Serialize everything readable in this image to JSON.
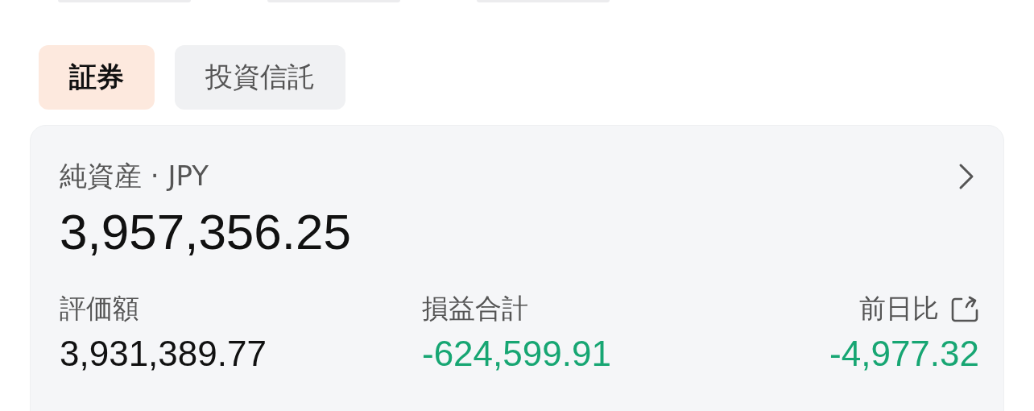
{
  "tabs": [
    {
      "label": "証券",
      "selected": true
    },
    {
      "label": "投資信託",
      "selected": false
    }
  ],
  "summary": {
    "title": "純資産 · JPY",
    "value": "3,957,356.25",
    "metrics": [
      {
        "label": "評価額",
        "value": "3,931,389.77",
        "color": "#111111",
        "share": false
      },
      {
        "label": "損益合計",
        "value": "-624,599.91",
        "color": "#17a673",
        "share": false
      },
      {
        "label": "前日比",
        "value": "-4,977.32",
        "color": "#17a673",
        "share": true
      }
    ]
  }
}
